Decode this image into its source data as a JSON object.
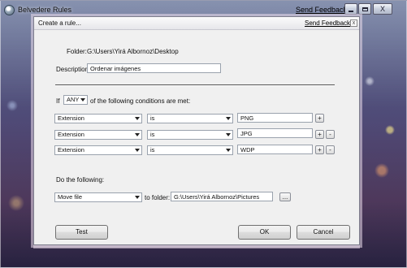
{
  "outer_window": {
    "title": "Belvedere Rules",
    "send_feedback": "Send Feedback",
    "close_glyph": "X"
  },
  "dialog": {
    "title": "Create a rule...",
    "send_feedback": "Send Feedback",
    "close_glyph": "x",
    "folder_label": "Folder:",
    "folder_path": "G:\\Users\\Yirá Albornoz\\Desktop",
    "description_label": "Description:",
    "description_value": "Ordenar imágenes",
    "if_label": "If",
    "match_mode": "ANY",
    "conditions_suffix": "of the following conditions are met:",
    "conditions": [
      {
        "field": "Extension",
        "operator": "is",
        "value": "PNG",
        "buttons": [
          "+"
        ]
      },
      {
        "field": "Extension",
        "operator": "is",
        "value": "JPG",
        "buttons": [
          "+",
          "-"
        ]
      },
      {
        "field": "Extension",
        "operator": "is",
        "value": "WDP",
        "buttons": [
          "+",
          "-"
        ]
      }
    ],
    "do_following_label": "Do the following:",
    "action": "Move file",
    "to_folder_label": "to folder:",
    "to_folder_value": "G:\\Users\\Yirá Albornoz\\Pictures",
    "browse_label": "...",
    "test_button": "Test",
    "ok_button": "OK",
    "cancel_button": "Cancel"
  }
}
